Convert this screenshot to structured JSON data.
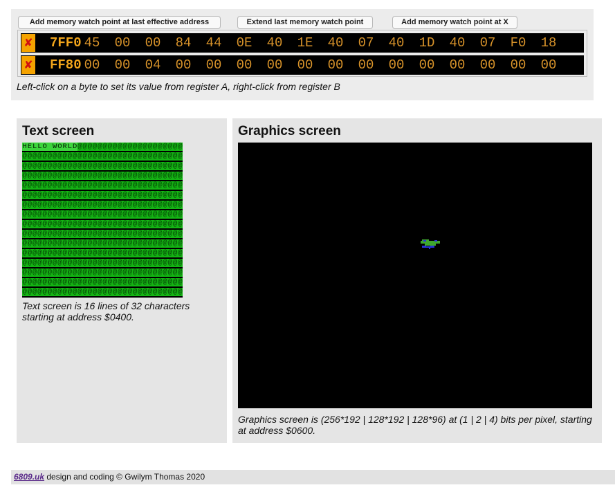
{
  "toolbar": {
    "add_ea_label": "Add memory watch point at last effective address",
    "extend_label": "Extend last memory watch point",
    "add_x_label": "Add memory watch point at X"
  },
  "watch": {
    "delete_glyph": "✘",
    "rows": [
      {
        "address": "7FF0",
        "bytes": [
          "45",
          "00",
          "00",
          "84",
          "44",
          "0E",
          "40",
          "1E",
          "40",
          "07",
          "40",
          "1D",
          "40",
          "07",
          "F0",
          "18"
        ]
      },
      {
        "address": "FF80",
        "bytes": [
          "00",
          "00",
          "04",
          "00",
          "00",
          "00",
          "00",
          "00",
          "00",
          "00",
          "00",
          "00",
          "00",
          "00",
          "00",
          "00"
        ]
      }
    ],
    "hint": "Left-click on a byte to set its value from register A, right-click from register B"
  },
  "text_screen": {
    "title": "Text screen",
    "first_line": "HELLO WORLD@@@@@@@@@@@@@@@@@@@@@",
    "fill_line": "@@@@@@@@@@@@@@@@@@@@@@@@@@@@@@@@",
    "lines": 16,
    "columns": 32,
    "highlight_count": 11,
    "caption": "Text screen is 16 lines of 32 characters starting at address $0400."
  },
  "graphics_screen": {
    "title": "Graphics screen",
    "caption": "Graphics screen is (256*192 | 128*192 | 128*96) at (1 | 2 | 4) bits per pixel, starting at address $0600."
  },
  "footer": {
    "link_text": "6809.uk",
    "text": " design and coding © Gwilym Thomas 2020"
  },
  "colors": {
    "watch_bg": "#000000",
    "byte_color": "#d8932a",
    "address_color": "#f3a61b",
    "delete_bg": "#f5a300",
    "text_screen_green": "#14b414",
    "sprite_green": "#3fa82e",
    "sprite_blue": "#2a35d6"
  }
}
